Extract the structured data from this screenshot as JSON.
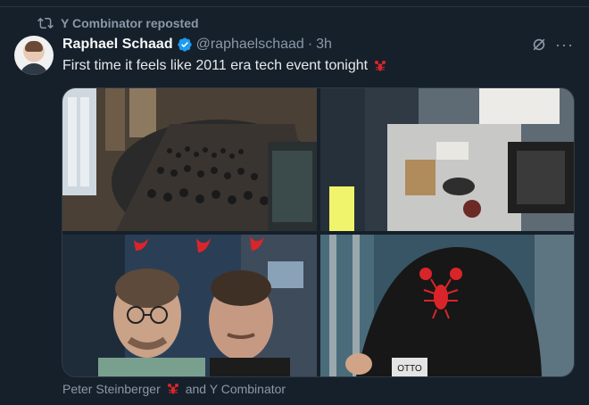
{
  "repost": {
    "label": "Y Combinator reposted"
  },
  "tweet": {
    "author_name": "Raphael Schaad",
    "handle": "@raphaelschaad",
    "separator": "·",
    "time": "3h",
    "text": "First time it feels like 2011 era tech event tonight"
  },
  "media_caption": {
    "name": "Peter Steinberger",
    "suffix": "and Y Combinator"
  },
  "photo4": {
    "cap_tag": "OTTO"
  },
  "icons": {
    "repost": "repost-icon",
    "verified": "verified-badge-icon",
    "grok": "grok-icon",
    "more": "more-icon",
    "lobster": "lobster-emoji-icon"
  },
  "colors": {
    "background": "#15202b",
    "muted_text": "#8b98a5",
    "verified_blue": "#1d9bf0",
    "lobster_red": "#d9252a"
  }
}
